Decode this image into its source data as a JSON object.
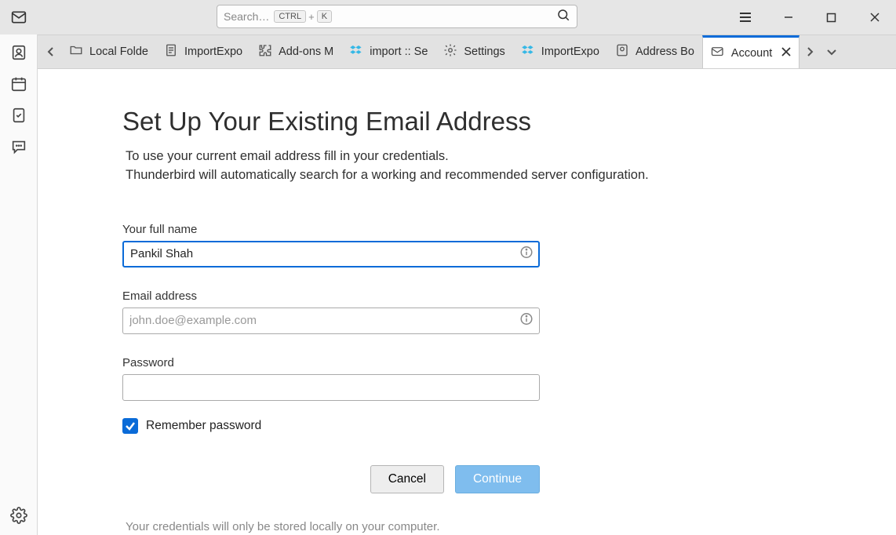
{
  "topbar": {
    "search_placeholder": "Search…",
    "shortcut_ctrl": "CTRL",
    "shortcut_plus": "+",
    "shortcut_k": "K"
  },
  "tabs": {
    "t0": "Local Folde",
    "t1": "ImportExpo",
    "t2": "Add-ons M",
    "t3": "import :: Se",
    "t4": "Settings",
    "t5": "ImportExpo",
    "t6": "Address Bo",
    "t7": "Account"
  },
  "setup": {
    "title": "Set Up Your Existing Email Address",
    "sub1": "To use your current email address fill in your credentials.",
    "sub2": "Thunderbird will automatically search for a working and recommended server configuration.",
    "name_label": "Your full name",
    "name_value": "Pankil Shah",
    "email_label": "Email address",
    "email_placeholder": "john.doe@example.com",
    "password_label": "Password",
    "remember_label": "Remember password",
    "cancel": "Cancel",
    "continue": "Continue",
    "footnote": "Your credentials will only be stored locally on your computer."
  }
}
